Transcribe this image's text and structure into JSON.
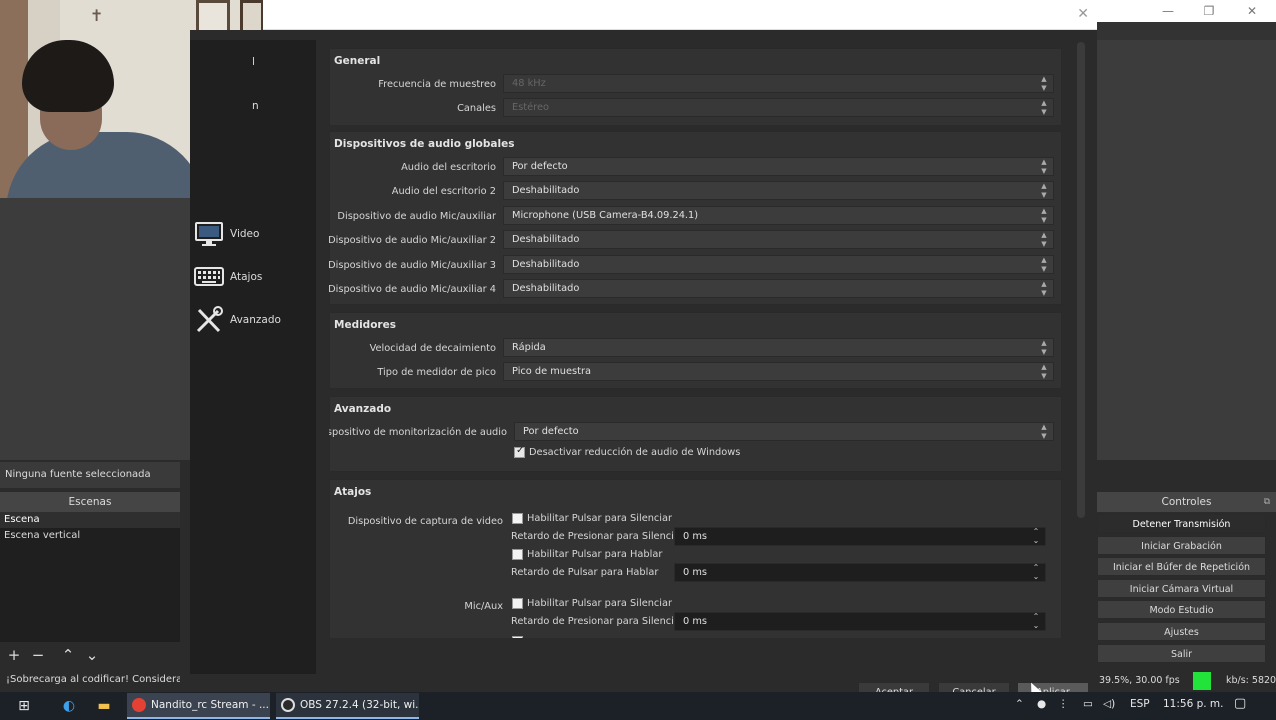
{
  "obs_main": {
    "source_status": "Ninguna fuente seleccionada",
    "scenes_header": "Escenas",
    "scenes": [
      "Escena",
      "Escena vertical"
    ],
    "scene_tools": [
      "+",
      "−",
      "⌃",
      "⌄"
    ],
    "status_warning": "¡Sobrecarga al codificar! Considera l",
    "controls_header": "Controles",
    "controls": [
      "Detener Transmisión",
      "Iniciar Grabación",
      "Iniciar el Búfer de Repetición",
      "Iniciar Cámara Virtual",
      "Modo Estudio",
      "Ajustes",
      "Salir"
    ],
    "cpu_fps": "39.5%, 30.00 fps",
    "kbs": "kb/s: 5820"
  },
  "settings": {
    "nav_partial": [
      "l",
      "n"
    ],
    "nav": [
      {
        "label": "Video",
        "icon": "monitor-icon"
      },
      {
        "label": "Atajos",
        "icon": "keyboard-icon"
      },
      {
        "label": "Avanzado",
        "icon": "tools-icon"
      }
    ],
    "general": {
      "title": "General",
      "sample_rate_label": "Frecuencia de muestreo",
      "sample_rate_value": "48 kHz",
      "channels_label": "Canales",
      "channels_value": "Estéreo"
    },
    "global_audio": {
      "title": "Dispositivos de audio globales",
      "rows": [
        {
          "label": "Audio del escritorio",
          "value": "Por defecto"
        },
        {
          "label": "Audio del escritorio 2",
          "value": "Deshabilitado"
        },
        {
          "label": "Dispositivo de audio Mic/auxiliar",
          "value": "Microphone (USB Camera-B4.09.24.1)"
        },
        {
          "label": "Dispositivo de audio Mic/auxiliar 2",
          "value": "Deshabilitado"
        },
        {
          "label": "Dispositivo de audio Mic/auxiliar 3",
          "value": "Deshabilitado"
        },
        {
          "label": "Dispositivo de audio Mic/auxiliar 4",
          "value": "Deshabilitado"
        }
      ]
    },
    "meters": {
      "title": "Medidores",
      "rows": [
        {
          "label": "Velocidad de decaimiento",
          "value": "Rápida"
        },
        {
          "label": "Tipo de medidor de pico",
          "value": "Pico de muestra"
        }
      ]
    },
    "advanced": {
      "title": "Avanzado",
      "monitor_label": "Dispositivo de monitorización de audio",
      "monitor_value": "Por defecto",
      "ducking_label": "Desactivar reducción de audio de Windows",
      "ducking_checked": true
    },
    "hotkeys": {
      "title": "Atajos",
      "video_capture_label": "Dispositivo de captura de video",
      "mic_aux_label": "Mic/Aux",
      "push_to_mute": "Habilitar Pulsar para Silenciar",
      "push_to_mute_delay_label": "Retardo de Presionar para Silenciar",
      "push_to_talk": "Habilitar Pulsar para Hablar",
      "push_to_talk_delay_label": "Retardo de Pulsar para Hablar",
      "delay_value": "0 ms"
    },
    "buttons": {
      "accept": "Aceptar",
      "cancel": "Cancelar",
      "apply": "Aplicar"
    }
  },
  "taskbar": {
    "tasks": [
      {
        "label": "Nandito_rc Stream - ...",
        "icon_color": "#e34133"
      },
      {
        "label": "OBS 27.2.4 (32-bit, wi...",
        "icon_color": "#2a2a2a"
      }
    ],
    "lang": "ESP",
    "time": "11:56 p. m."
  }
}
